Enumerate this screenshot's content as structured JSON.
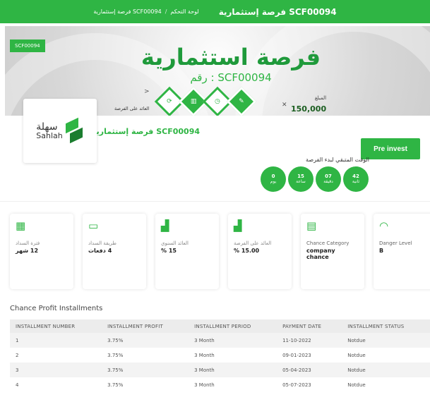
{
  "topbar": {
    "title": "SCF00094 فرصة إستثمارية",
    "breadcrumb": [
      "لوحة التحكم",
      "/",
      "SCF00094 فرصة إستثمارية"
    ]
  },
  "banner": {
    "ref_badge": "SCF00094",
    "hero_title": "فرصة استثمارية",
    "hero_number": "SCF00094 : رقم",
    "amount_label": "المبلغ",
    "amount_value": "150,000",
    "return_label": "العائد على الفرصة"
  },
  "company": {
    "logo_ar": "سهلة",
    "logo_en": "Sahlah"
  },
  "opportunity": {
    "title": "SCF00094 فرصة إستثمارية",
    "preinvest_label": "Pre invest",
    "remaining_label": "الوقت المتبقي لبدء الفرصة",
    "countdown": [
      {
        "value": "0",
        "unit": "يوم"
      },
      {
        "value": "15",
        "unit": "ساعة"
      },
      {
        "value": "07",
        "unit": "دقيقة"
      },
      {
        "value": "42",
        "unit": "ثانية"
      }
    ]
  },
  "cards": [
    {
      "icon": "calendar-icon",
      "label": "فترة السداد",
      "value": "12 شهر"
    },
    {
      "icon": "card-icon",
      "label": "طريقة السداد",
      "value": "4 دفعات"
    },
    {
      "icon": "chart-coins-icon",
      "label": "العائد السنوي",
      "value": "15 %"
    },
    {
      "icon": "chart-coins-icon",
      "label": "العائد على الفرصة",
      "value": "15.00 %"
    },
    {
      "icon": "building-icon",
      "label": "Chance Category",
      "value": "company chance"
    },
    {
      "icon": "gauge-icon",
      "label": "Danger Level",
      "value": "B"
    }
  ],
  "installments": {
    "title": "Chance Profit Installments",
    "headers": [
      "INSTALLMENT NUMBER",
      "INSTALLMENT PROFIT",
      "INSTALLMENT PERIOD",
      "PAYMENT DATE",
      "INSTALLMENT STATUS"
    ],
    "rows": [
      [
        "1",
        "3.75%",
        "3 Month",
        "11-10-2022",
        "Notdue"
      ],
      [
        "2",
        "3.75%",
        "3 Month",
        "09-01-2023",
        "Notdue"
      ],
      [
        "3",
        "3.75%",
        "3 Month",
        "05-04-2023",
        "Notdue"
      ],
      [
        "4",
        "3.75%",
        "3 Month",
        "05-07-2023",
        "Notdue"
      ]
    ]
  },
  "colors": {
    "accent": "#2fb544",
    "accent_dark": "#1b7d2f"
  }
}
